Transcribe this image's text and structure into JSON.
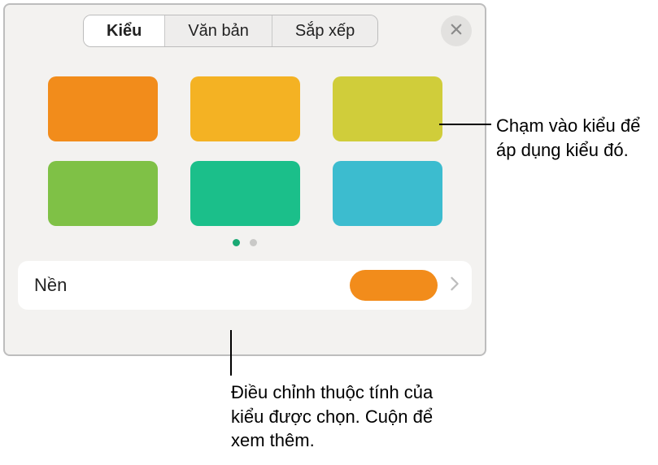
{
  "tabs": {
    "style": "Kiểu",
    "text": "Văn bản",
    "arrange": "Sắp xếp"
  },
  "swatches": {
    "c0": "#f28c1b",
    "c1": "#f4b223",
    "c2": "#d0cd3a",
    "c3": "#7fc146",
    "c4": "#1bbf8a",
    "c5": "#3cbccf"
  },
  "row": {
    "label": "Nền",
    "swatch": "#f28c1b"
  },
  "callouts": {
    "right": "Chạm vào kiểu để áp dụng kiểu đó.",
    "bottom": "Điều chỉnh thuộc tính của kiểu được chọn. Cuộn để xem thêm."
  }
}
